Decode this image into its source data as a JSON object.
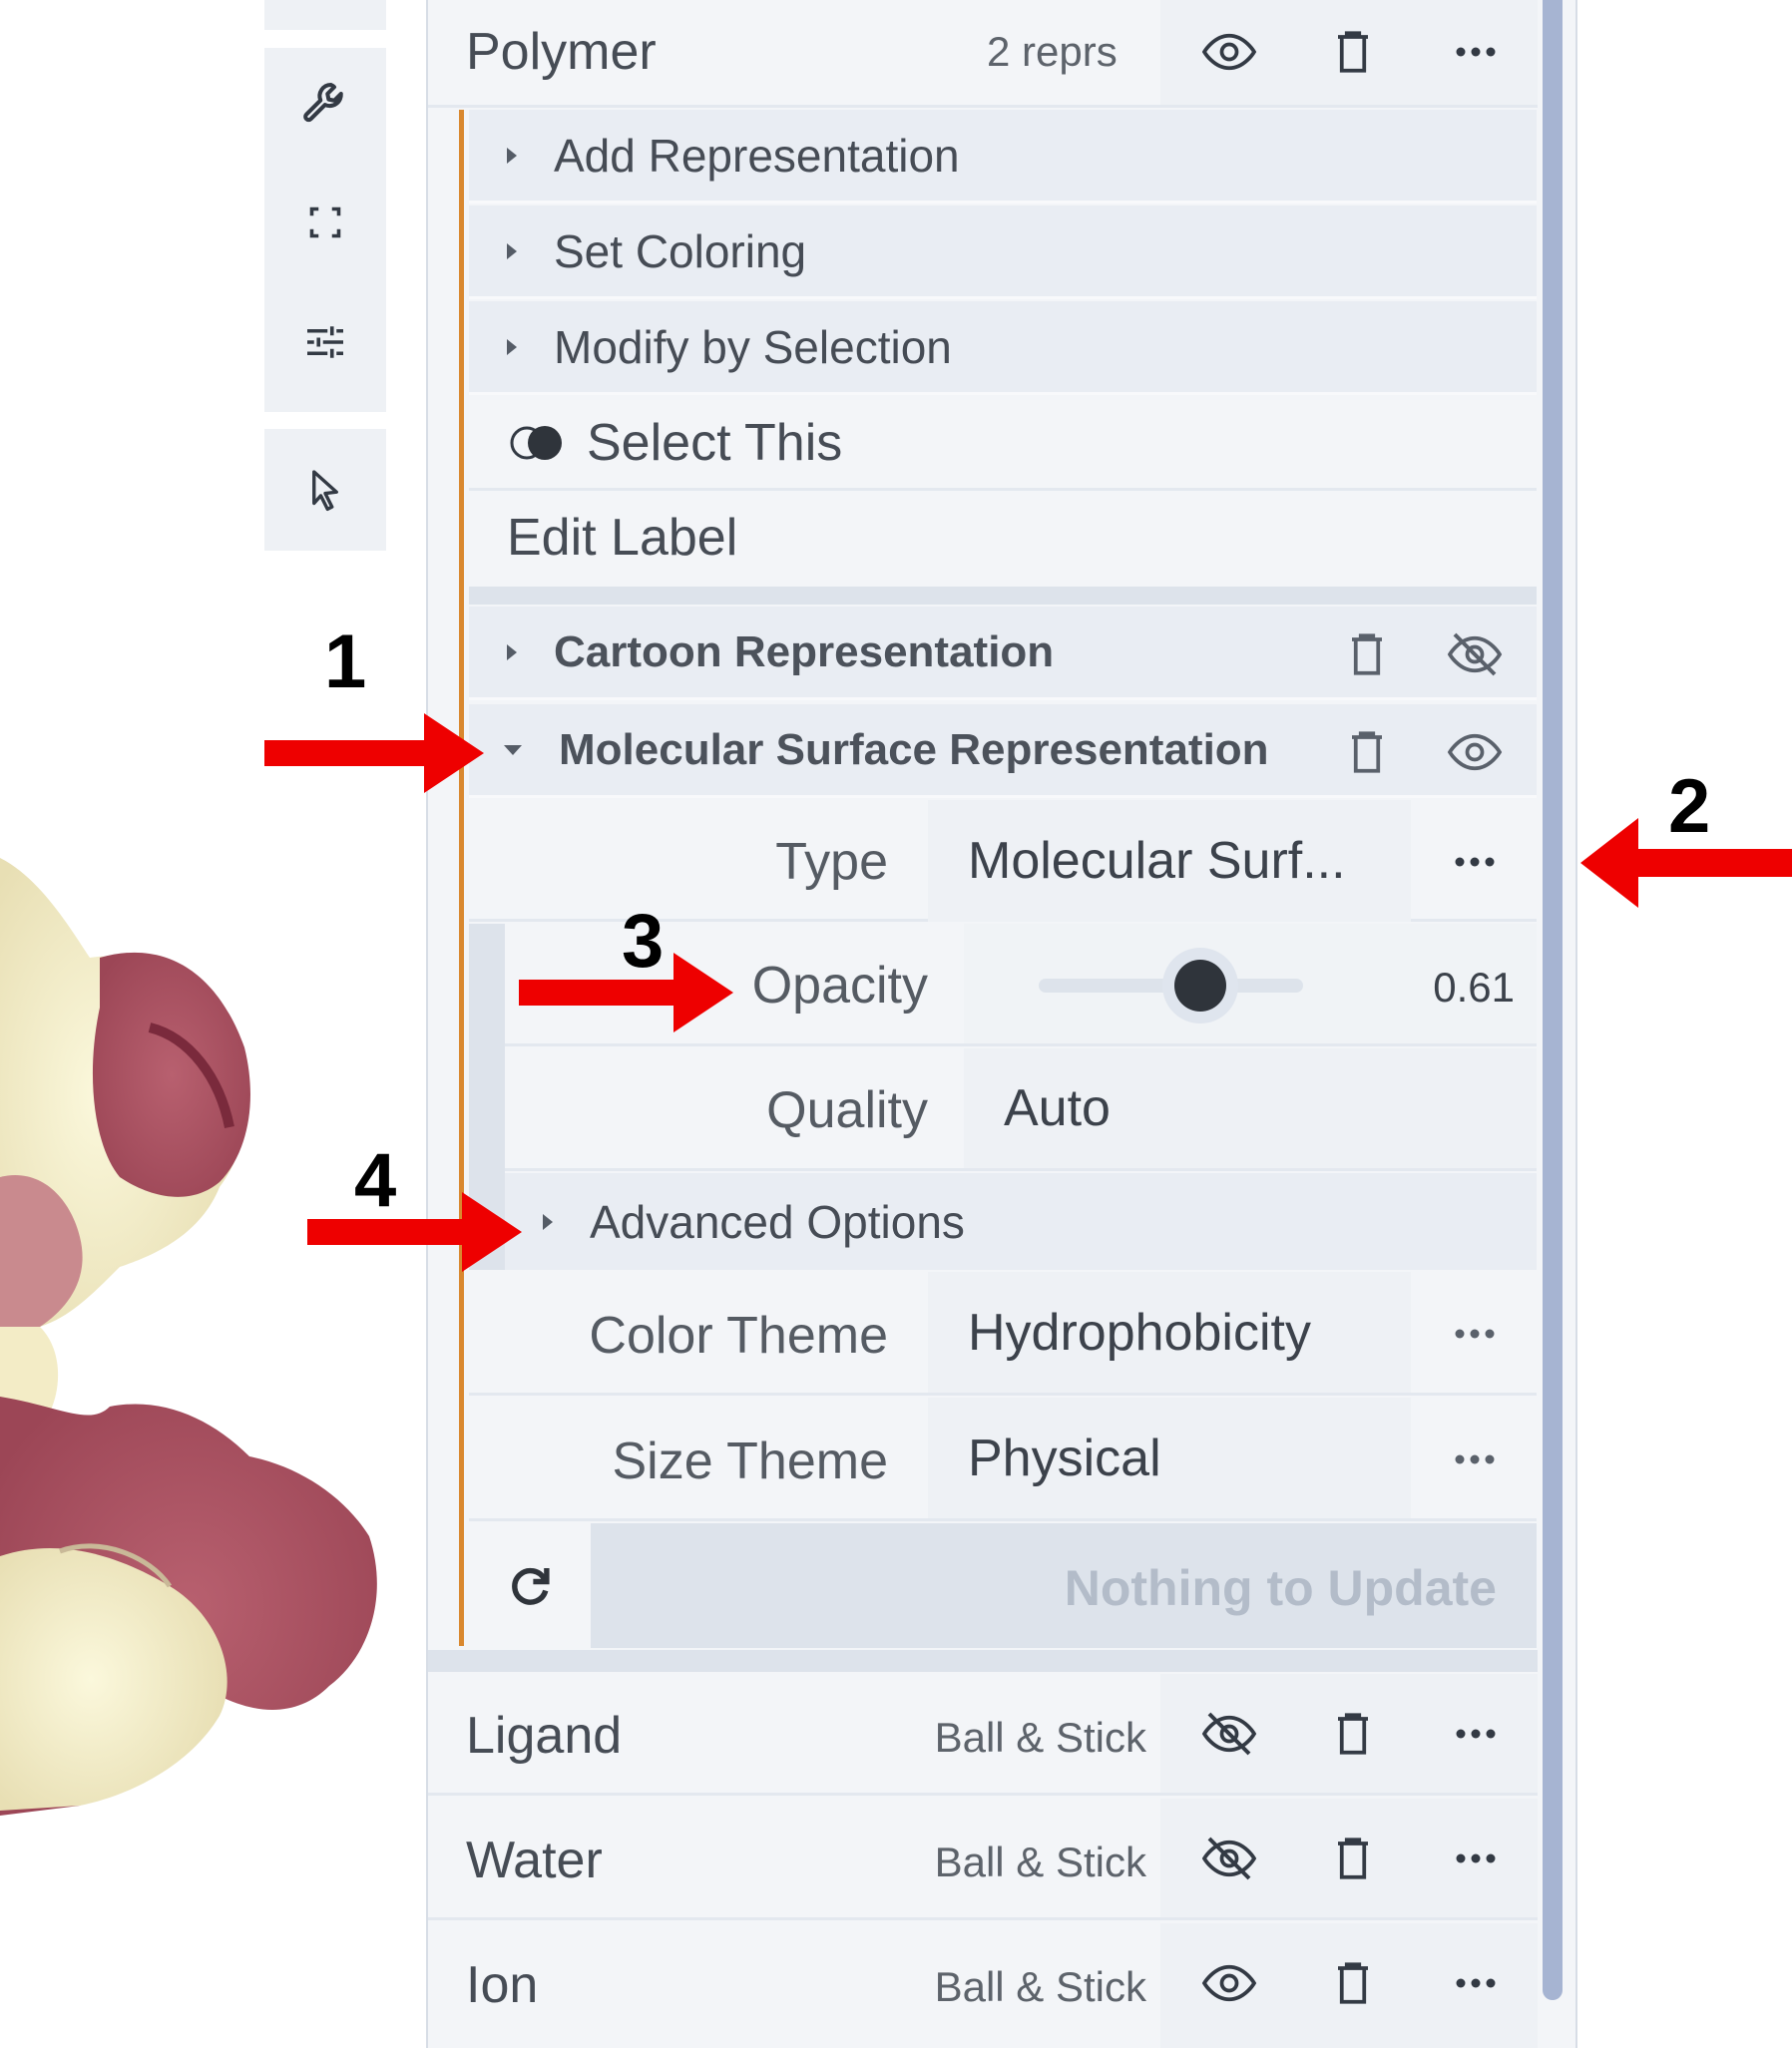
{
  "toolbar": {
    "icons": [
      "wrench-icon",
      "fullscreen-icon",
      "sliders-icon",
      "cursor-icon"
    ]
  },
  "polymer": {
    "label": "Polymer",
    "count": "2 reprs",
    "actions": {
      "add_representation": "Add Representation",
      "set_coloring": "Set Coloring",
      "modify_by_selection": "Modify by Selection",
      "select_this": "Select This",
      "edit_label": "Edit Label"
    },
    "representations": {
      "cartoon": "Cartoon Representation",
      "surface": "Molecular Surface Representation"
    },
    "params": {
      "type_label": "Type",
      "type_value": "Molecular Surf...",
      "opacity_label": "Opacity",
      "opacity_value": "0.61",
      "opacity_fraction": 0.61,
      "quality_label": "Quality",
      "quality_value": "Auto",
      "advanced_label": "Advanced Options",
      "color_theme_label": "Color Theme",
      "color_theme_value": "Hydrophobicity",
      "size_theme_label": "Size Theme",
      "size_theme_value": "Physical"
    },
    "update_label": "Nothing to Update"
  },
  "components": [
    {
      "label": "Ligand",
      "repr": "Ball & Stick",
      "visible": false
    },
    {
      "label": "Water",
      "repr": "Ball & Stick",
      "visible": false
    },
    {
      "label": "Ion",
      "repr": "Ball & Stick",
      "visible": true
    }
  ],
  "annotations": [
    "1",
    "2",
    "3",
    "4"
  ],
  "colors": {
    "accent": "#d9882f",
    "arrow": "#ee0000",
    "surface_red": "#b25a6c",
    "surface_yellow": "#f7f3cf"
  }
}
